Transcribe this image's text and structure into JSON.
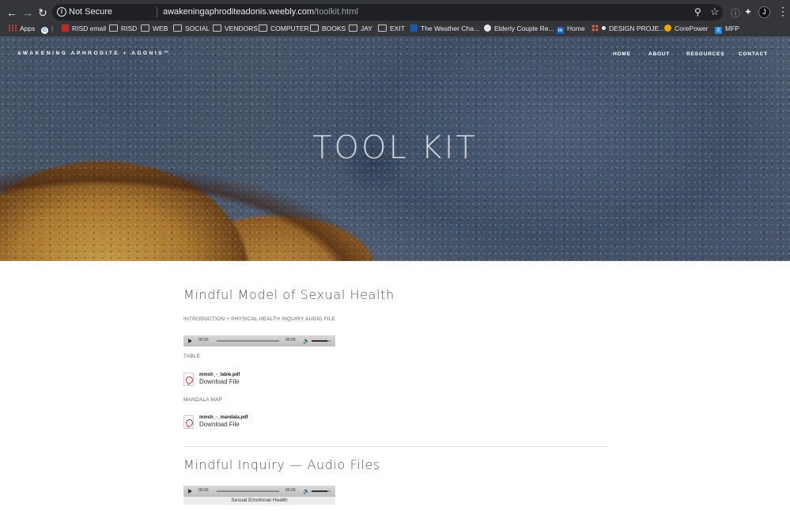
{
  "browser": {
    "security_label": "Not Secure",
    "url_host": "awakeningaphroditeadonis.weebly.com",
    "url_path": "/toolkit.html",
    "bookmarks": [
      {
        "label": "Apps",
        "icon": "apps-grid-icon"
      },
      {
        "label": "",
        "icon": "google-icon"
      },
      {
        "label": "RISD email",
        "icon": "risd-icon"
      },
      {
        "label": "RISD",
        "icon": "folder-icon"
      },
      {
        "label": "WEB",
        "icon": "folder-icon"
      },
      {
        "label": "SOCIAL",
        "icon": "folder-icon"
      },
      {
        "label": "VENDORS",
        "icon": "folder-icon"
      },
      {
        "label": "COMPUTER",
        "icon": "folder-icon"
      },
      {
        "label": "BOOKS",
        "icon": "folder-icon"
      },
      {
        "label": "JAY",
        "icon": "folder-icon"
      },
      {
        "label": "EXIT",
        "icon": "folder-icon"
      },
      {
        "label": "The Weather Cha...",
        "icon": "weather-icon"
      },
      {
        "label": "Elderly Couple Re...",
        "icon": "circle-icon"
      },
      {
        "label": "Home",
        "icon": "linkedin-icon"
      },
      {
        "label": "DESIGN PROJE...",
        "icon": "asana-icon"
      },
      {
        "label": "CorePower",
        "icon": "corepower-icon"
      },
      {
        "label": "MFP",
        "icon": "mfp-icon"
      }
    ]
  },
  "site": {
    "logo": "AWAKENING APHRODITE + ADONIS™",
    "nav": [
      "HOME",
      "ABOUT",
      "RESOURCES",
      "CONTACT"
    ],
    "hero_title": "TOOL KIT"
  },
  "sections": [
    {
      "title": "Mindful Model of Sexual Health",
      "intro_label": "INTRODUCTION + PHYSICAL HEALTH INQUIRY AUDIO FILE",
      "audio": {
        "current": "00:00",
        "duration": "00:00"
      },
      "table_label": "TABLE",
      "table_file": {
        "name": "mmsh_-_table.pdf",
        "action": "Download File"
      },
      "mandala_label": "MANDALA MAP",
      "mandala_file": {
        "name": "mmsh_-_mandala.pdf",
        "action": "Download File"
      }
    },
    {
      "title": "Mindful Inquiry — Audio Files",
      "audio": {
        "current": "00:00",
        "duration": "00:00",
        "caption": "Sexual Emotional Health"
      }
    }
  ]
}
